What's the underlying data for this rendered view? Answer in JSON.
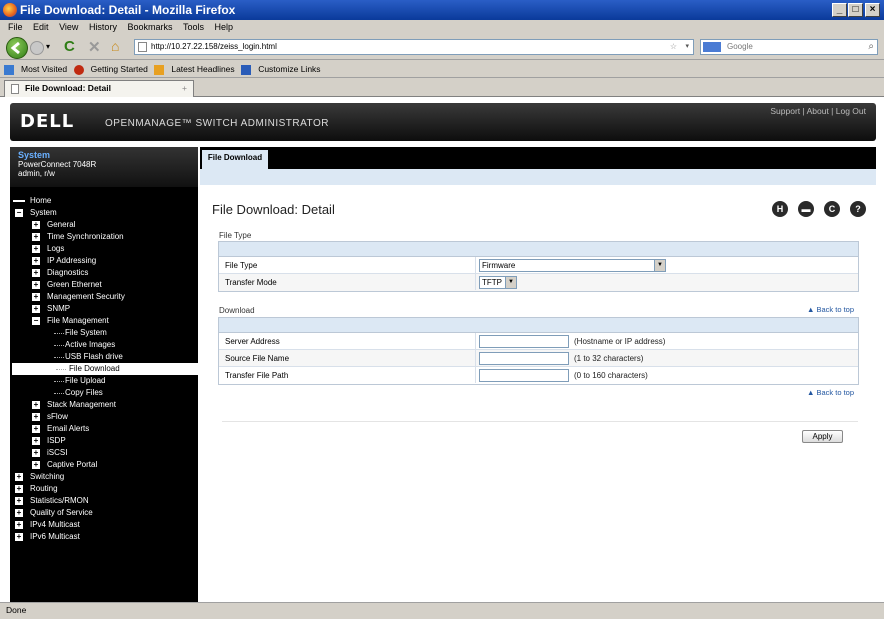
{
  "window": {
    "title": "File Download: Detail - Mozilla Firefox",
    "min": "_",
    "max": "□",
    "close": "×"
  },
  "menu": [
    "File",
    "Edit",
    "View",
    "History",
    "Bookmarks",
    "Tools",
    "Help"
  ],
  "nav": {
    "url": "http://10.27.22.158/zeiss_login.html",
    "search_placeholder": "Google"
  },
  "bookmarks": [
    "Most Visited",
    "Getting Started",
    "Latest Headlines",
    "Customize Links"
  ],
  "tab": {
    "title": "File Download: Detail",
    "new_tab": "+"
  },
  "header": {
    "logo": "DELL",
    "app_title": "OPENMANAGE™ SWITCH ADMINISTRATOR",
    "links": "Support | About | Log Out"
  },
  "system": {
    "title": "System",
    "model": "PowerConnect 7048R",
    "user": "admin, r/w"
  },
  "tree": [
    {
      "label": "Home",
      "level": 0,
      "pm": ""
    },
    {
      "label": "System",
      "level": 0,
      "pm": "-"
    },
    {
      "label": "General",
      "level": 1,
      "pm": "+"
    },
    {
      "label": "Time Synchronization",
      "level": 1,
      "pm": "+"
    },
    {
      "label": "Logs",
      "level": 1,
      "pm": "+"
    },
    {
      "label": "IP Addressing",
      "level": 1,
      "pm": "+"
    },
    {
      "label": "Diagnostics",
      "level": 1,
      "pm": "+"
    },
    {
      "label": "Green Ethernet",
      "level": 1,
      "pm": "+"
    },
    {
      "label": "Management Security",
      "level": 1,
      "pm": "+"
    },
    {
      "label": "SNMP",
      "level": 1,
      "pm": "+"
    },
    {
      "label": "File Management",
      "level": 1,
      "pm": "-"
    },
    {
      "label": "File System",
      "level": 2,
      "pm": ""
    },
    {
      "label": "Active Images",
      "level": 2,
      "pm": ""
    },
    {
      "label": "USB Flash drive",
      "level": 2,
      "pm": ""
    },
    {
      "label": "File Download",
      "level": 2,
      "pm": "",
      "selected": true
    },
    {
      "label": "File Upload",
      "level": 2,
      "pm": ""
    },
    {
      "label": "Copy Files",
      "level": 2,
      "pm": ""
    },
    {
      "label": "Stack Management",
      "level": 1,
      "pm": "+"
    },
    {
      "label": "sFlow",
      "level": 1,
      "pm": "+"
    },
    {
      "label": "Email Alerts",
      "level": 1,
      "pm": "+"
    },
    {
      "label": "ISDP",
      "level": 1,
      "pm": "+"
    },
    {
      "label": "iSCSI",
      "level": 1,
      "pm": "+"
    },
    {
      "label": "Captive Portal",
      "level": 1,
      "pm": "+"
    },
    {
      "label": "Switching",
      "level": 0,
      "pm": "+"
    },
    {
      "label": "Routing",
      "level": 0,
      "pm": "+"
    },
    {
      "label": "Statistics/RMON",
      "level": 0,
      "pm": "+"
    },
    {
      "label": "Quality of Service",
      "level": 0,
      "pm": "+"
    },
    {
      "label": "IPv4 Multicast",
      "level": 0,
      "pm": "+"
    },
    {
      "label": "IPv6 Multicast",
      "level": 0,
      "pm": "+"
    }
  ],
  "main": {
    "tab_label": "File Download",
    "page_title": "File Download: Detail",
    "toolbar_icons": [
      "save-icon",
      "print-icon",
      "refresh-icon",
      "help-icon"
    ],
    "toolbar_glyphs": [
      "H",
      "▬",
      "C",
      "?"
    ],
    "file_type_section": "File Type",
    "file_type_label": "File Type",
    "file_type_value": "Firmware",
    "transfer_mode_label": "Transfer Mode",
    "transfer_mode_value": "TFTP",
    "download_section": "Download",
    "back_to_top": "▲ Back to top",
    "server_address_label": "Server Address",
    "server_address_hint": "(Hostname or IP address)",
    "source_file_label": "Source File Name",
    "source_file_hint": "(1 to 32 characters)",
    "transfer_path_label": "Transfer File Path",
    "transfer_path_hint": "(0 to 160 characters)",
    "apply": "Apply"
  },
  "status": "Done"
}
